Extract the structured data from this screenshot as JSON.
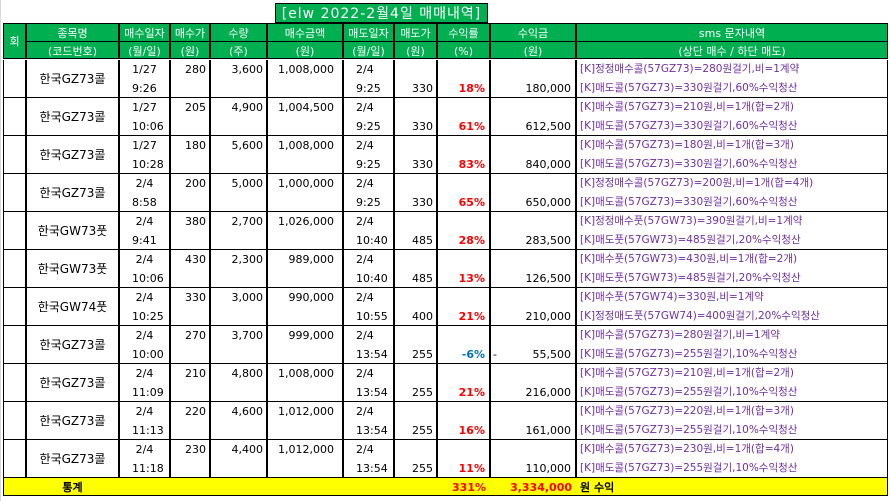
{
  "title": "[elw 2022-2월4일 매매내역]",
  "headers": {
    "col0": "회",
    "col1": [
      "종목명",
      "(코드번호)"
    ],
    "col2": [
      "매수일자",
      "(월/일)"
    ],
    "col3": [
      "매수가",
      "(원)"
    ],
    "col4": [
      "수량",
      "(주)"
    ],
    "col5": [
      "매수금액",
      "(원)"
    ],
    "col6": [
      "매도일자",
      "(월/일)"
    ],
    "col7": [
      "매도가",
      "(원)"
    ],
    "col8": [
      "수익률",
      "(%)"
    ],
    "col9": [
      "수익금",
      "(원)"
    ],
    "col10": [
      "sms 문자내역",
      "(상단 매수 / 하단 매도)"
    ]
  },
  "rows": [
    {
      "name": "한국GZ73콜",
      "buy_date": "1/27",
      "buy_time": "9:26",
      "buy_price": "280",
      "qty": "3,600",
      "buy_amount": "1,008,000",
      "sell_date": "2/4",
      "sell_time": "9:25",
      "sell_price": "330",
      "return_pct": "18%",
      "profit": "180,000",
      "neg_mark": "",
      "sms_buy": "[K]정정매수콜(57GZ73)=280원걸기,비=1계약",
      "sms_sell": "[K]매도콜(57GZ73)=330원걸기,60%수익청산"
    },
    {
      "name": "한국GZ73콜",
      "buy_date": "1/27",
      "buy_time": "10:06",
      "buy_price": "205",
      "qty": "4,900",
      "buy_amount": "1,004,500",
      "sell_date": "2/4",
      "sell_time": "9:25",
      "sell_price": "330",
      "return_pct": "61%",
      "profit": "612,500",
      "neg_mark": "",
      "sms_buy": "[K]매수콜(57GZ73)=210원,비=1개(합=2개)",
      "sms_sell": "[K]매도콜(57GZ73)=330원걸기,60%수익청산"
    },
    {
      "name": "한국GZ73콜",
      "buy_date": "1/27",
      "buy_time": "10:28",
      "buy_price": "180",
      "qty": "5,600",
      "buy_amount": "1,008,000",
      "sell_date": "2/4",
      "sell_time": "9:25",
      "sell_price": "330",
      "return_pct": "83%",
      "profit": "840,000",
      "neg_mark": "",
      "sms_buy": "[K]매수콜(57GZ73)=180원,비=1개(합=3개)",
      "sms_sell": "[K]매도콜(57GZ73)=330원걸기,60%수익청산"
    },
    {
      "name": "한국GZ73콜",
      "buy_date": "2/4",
      "buy_time": "8:58",
      "buy_price": "200",
      "qty": "5,000",
      "buy_amount": "1,000,000",
      "sell_date": "2/4",
      "sell_time": "9:25",
      "sell_price": "330",
      "return_pct": "65%",
      "profit": "650,000",
      "neg_mark": "",
      "sms_buy": "[K]정정매수콜(57GZ73)=200원,비=1개(합=4개)",
      "sms_sell": "[K]매도콜(57GZ73)=330원걸기,60%수익청산"
    },
    {
      "name": "한국GW73풋",
      "buy_date": "2/4",
      "buy_time": "9:41",
      "buy_price": "380",
      "qty": "2,700",
      "buy_amount": "1,026,000",
      "sell_date": "2/4",
      "sell_time": "10:40",
      "sell_price": "485",
      "return_pct": "28%",
      "profit": "283,500",
      "neg_mark": "",
      "sms_buy": "[K]정정매수풋(57GW73)=390원걸기,비=1계약",
      "sms_sell": "[K]매도풋(57GW73)=485원걸기,20%수익청산"
    },
    {
      "name": "한국GW73풋",
      "buy_date": "2/4",
      "buy_time": "10:06",
      "buy_price": "430",
      "qty": "2,300",
      "buy_amount": "989,000",
      "sell_date": "2/4",
      "sell_time": "10:40",
      "sell_price": "485",
      "return_pct": "13%",
      "profit": "126,500",
      "neg_mark": "",
      "sms_buy": "[K]매수풋(57GW73)=430원,비=1개(합=2개)",
      "sms_sell": "[K]매도풋(57GW73)=485원걸기,20%수익청산"
    },
    {
      "name": "한국GW74풋",
      "buy_date": "2/4",
      "buy_time": "10:25",
      "buy_price": "330",
      "qty": "3,000",
      "buy_amount": "990,000",
      "sell_date": "2/4",
      "sell_time": "10:55",
      "sell_price": "400",
      "return_pct": "21%",
      "profit": "210,000",
      "neg_mark": "",
      "sms_buy": "[K]매수풋(57GW74)=330원,비=1계약",
      "sms_sell": "[K]정정매도풋(57GW74)=400원걸기,20%수익청산"
    },
    {
      "name": "한국GZ73콜",
      "buy_date": "2/4",
      "buy_time": "10:00",
      "buy_price": "270",
      "qty": "3,700",
      "buy_amount": "999,000",
      "sell_date": "2/4",
      "sell_time": "13:54",
      "sell_price": "255",
      "return_pct": "-6%",
      "profit": "55,500",
      "neg_mark": "-",
      "sms_buy": "[K]매수콜(57GZ73)=280원걸기,비=1계약",
      "sms_sell": "[K]매도콜(57GZ73)=255원걸기,10%수익청산"
    },
    {
      "name": "한국GZ73콜",
      "buy_date": "2/4",
      "buy_time": "11:09",
      "buy_price": "210",
      "qty": "4,800",
      "buy_amount": "1,008,000",
      "sell_date": "2/4",
      "sell_time": "13:54",
      "sell_price": "255",
      "return_pct": "21%",
      "profit": "216,000",
      "neg_mark": "",
      "sms_buy": "[K]매수콜(57GZ73)=210원,비=1개(합=2개)",
      "sms_sell": "[K]매도콜(57GZ73)=255원걸기,10%수익청산"
    },
    {
      "name": "한국GZ73콜",
      "buy_date": "2/4",
      "buy_time": "11:13",
      "buy_price": "220",
      "qty": "4,600",
      "buy_amount": "1,012,000",
      "sell_date": "2/4",
      "sell_time": "13:54",
      "sell_price": "255",
      "return_pct": "16%",
      "profit": "161,000",
      "neg_mark": "",
      "sms_buy": "[K]매수콜(57GZ73)=220원,비=1개(합=3개)",
      "sms_sell": "[K]매도콜(57GZ73)=255원걸기,10%수익청산"
    },
    {
      "name": "한국GZ73콜",
      "buy_date": "2/4",
      "buy_time": "11:18",
      "buy_price": "230",
      "qty": "4,400",
      "buy_amount": "1,012,000",
      "sell_date": "2/4",
      "sell_time": "13:54",
      "sell_price": "255",
      "return_pct": "11%",
      "profit": "110,000",
      "neg_mark": "",
      "sms_buy": "[K]매수콜(57GZ73)=230원,비=1개(합=4개)",
      "sms_sell": "[K]매도콜(57GZ73)=255원걸기,10%수익청산"
    }
  ],
  "totals": {
    "label": "통계",
    "return_pct": "331%",
    "profit": "3,334,000",
    "suffix": "원 수익"
  },
  "colors": {
    "header_green": "#00b050",
    "total_yellow": "#ffff00",
    "positive_red": "#ff0000",
    "negative_blue": "#0070c0",
    "sms_purple": "#7030a0"
  }
}
